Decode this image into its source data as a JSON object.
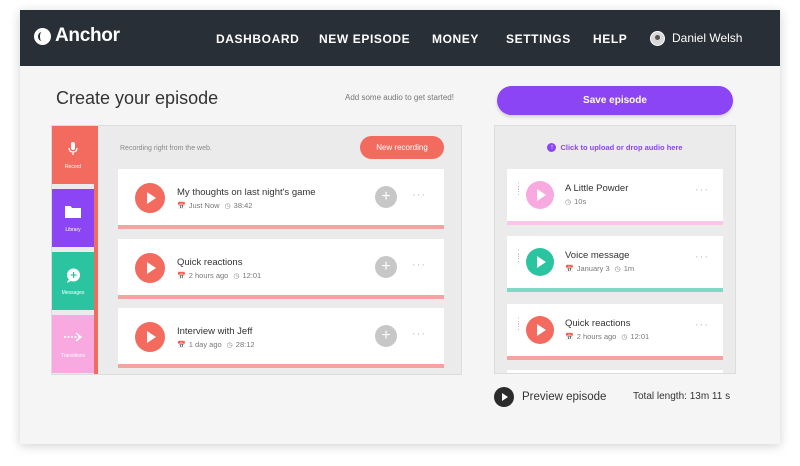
{
  "nav": {
    "logo_text": "Anchor",
    "items": [
      {
        "label": "DASHBOARD"
      },
      {
        "label": "NEW EPISODE"
      },
      {
        "label": "MONEY"
      },
      {
        "label": "SETTINGS"
      },
      {
        "label": "HELP"
      }
    ],
    "user_name": "Daniel Welsh"
  },
  "header": {
    "title": "Create your episode",
    "hint": "Add some audio to get started!",
    "save_label": "Save episode"
  },
  "sidebar": {
    "tabs": [
      {
        "label": "Record",
        "icon": "microphone-icon",
        "color": "#f36a5f"
      },
      {
        "label": "Library",
        "icon": "folder-icon",
        "color": "#8b45f5"
      },
      {
        "label": "Messages",
        "icon": "message-plus-icon",
        "color": "#2bc4a0"
      },
      {
        "label": "Transitions",
        "icon": "arrow-right-icon",
        "color": "#f7a9e0"
      }
    ]
  },
  "record_panel": {
    "description": "Recording right from the web.",
    "new_recording_label": "New recording",
    "recordings": [
      {
        "title": "My thoughts on last night's game",
        "date": "Just Now",
        "duration": "38:42"
      },
      {
        "title": "Quick reactions",
        "date": "2 hours ago",
        "duration": "12:01"
      },
      {
        "title": "Interview with Jeff",
        "date": "1 day ago",
        "duration": "28:12"
      }
    ]
  },
  "episode_panel": {
    "upload_label": "Click to upload or drop audio here",
    "segments": [
      {
        "title": "A Little Powder",
        "date": "",
        "duration": "10s",
        "color": "#f7a9e0"
      },
      {
        "title": "Voice message",
        "date": "January 3",
        "duration": "1m",
        "color": "#2bc4a0"
      },
      {
        "title": "Quick reactions",
        "date": "2 hours ago",
        "duration": "12:01",
        "color": "#f36a5f"
      }
    ]
  },
  "footer": {
    "preview_label": "Preview episode",
    "total_length": "Total length: 13m 11 s"
  },
  "colors": {
    "topbar": "#292f36",
    "accent_purple": "#8b45f5",
    "record_red": "#f36a5f",
    "message_green": "#2bc4a0",
    "transition_pink": "#f7a9e0",
    "bar_red": "#f5a3a0",
    "bar_pink": "#fbc4ea",
    "bar_green": "#7fd9c4"
  }
}
